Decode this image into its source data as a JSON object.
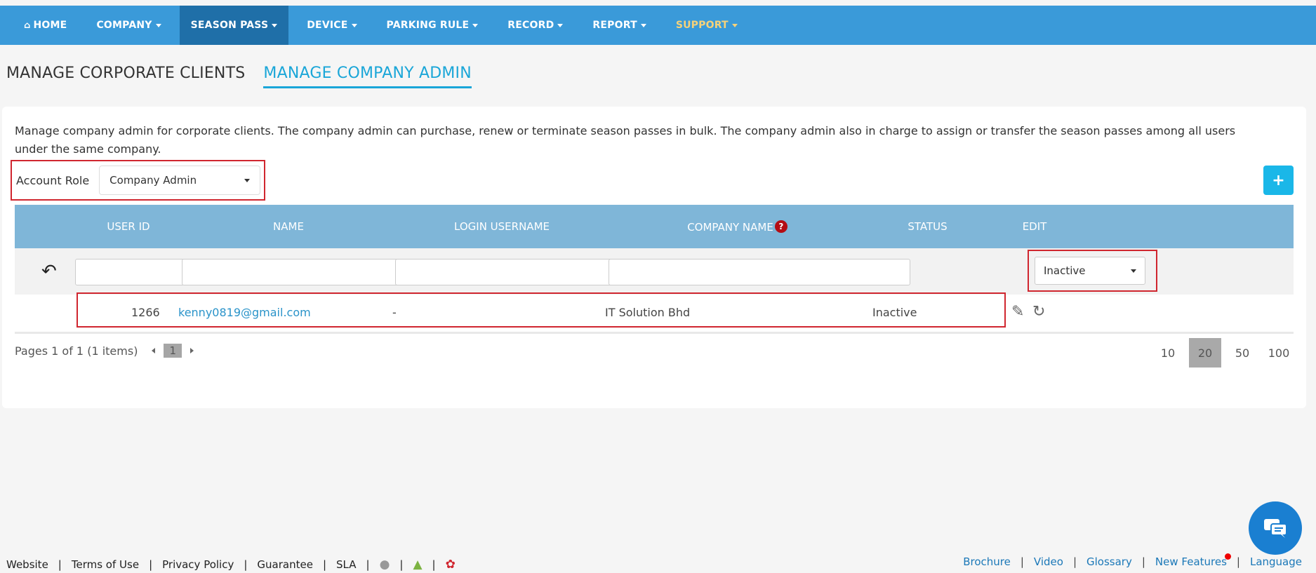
{
  "nav": {
    "home": "HOME",
    "company": "COMPANY",
    "season_pass": "SEASON PASS",
    "device": "DEVICE",
    "parking_rule": "PARKING RULE",
    "record": "RECORD",
    "report": "REPORT",
    "support": "SUPPORT"
  },
  "tabs": {
    "corporate_clients": "MANAGE CORPORATE CLIENTS",
    "company_admin": "MANAGE COMPANY ADMIN"
  },
  "description": "Manage company admin for corporate clients. The company admin can purchase, renew or terminate season passes in bulk. The company admin also in charge to assign or transfer the season passes among all users under the same company.",
  "account_role": {
    "label": "Account Role",
    "value": "Company Admin"
  },
  "add_button": "+",
  "table": {
    "headers": {
      "user_id": "USER ID",
      "name": "NAME",
      "login_username": "LOGIN USERNAME",
      "company_name": "COMPANY NAME",
      "status": "STATUS",
      "edit": "EDIT"
    },
    "filter_status": "Inactive",
    "rows": [
      {
        "user_id": "1266",
        "name": "kenny0819@gmail.com",
        "login_username": "-",
        "company_name": "IT Solution Bhd",
        "status": "Inactive"
      }
    ]
  },
  "pagination": {
    "summary": "Pages 1 of 1 (1 items)",
    "current_page": "1",
    "sizes": [
      "10",
      "20",
      "50",
      "100"
    ],
    "active_size": "20"
  },
  "footer": {
    "left": {
      "website": "Website",
      "terms": "Terms of Use",
      "privacy": "Privacy Policy",
      "guarantee": "Guarantee",
      "sla": "SLA",
      "separator": "|"
    },
    "right": {
      "brochure": "Brochure",
      "video": "Video",
      "glossary": "Glossary",
      "new_features": "New Features",
      "language": "Language"
    }
  }
}
